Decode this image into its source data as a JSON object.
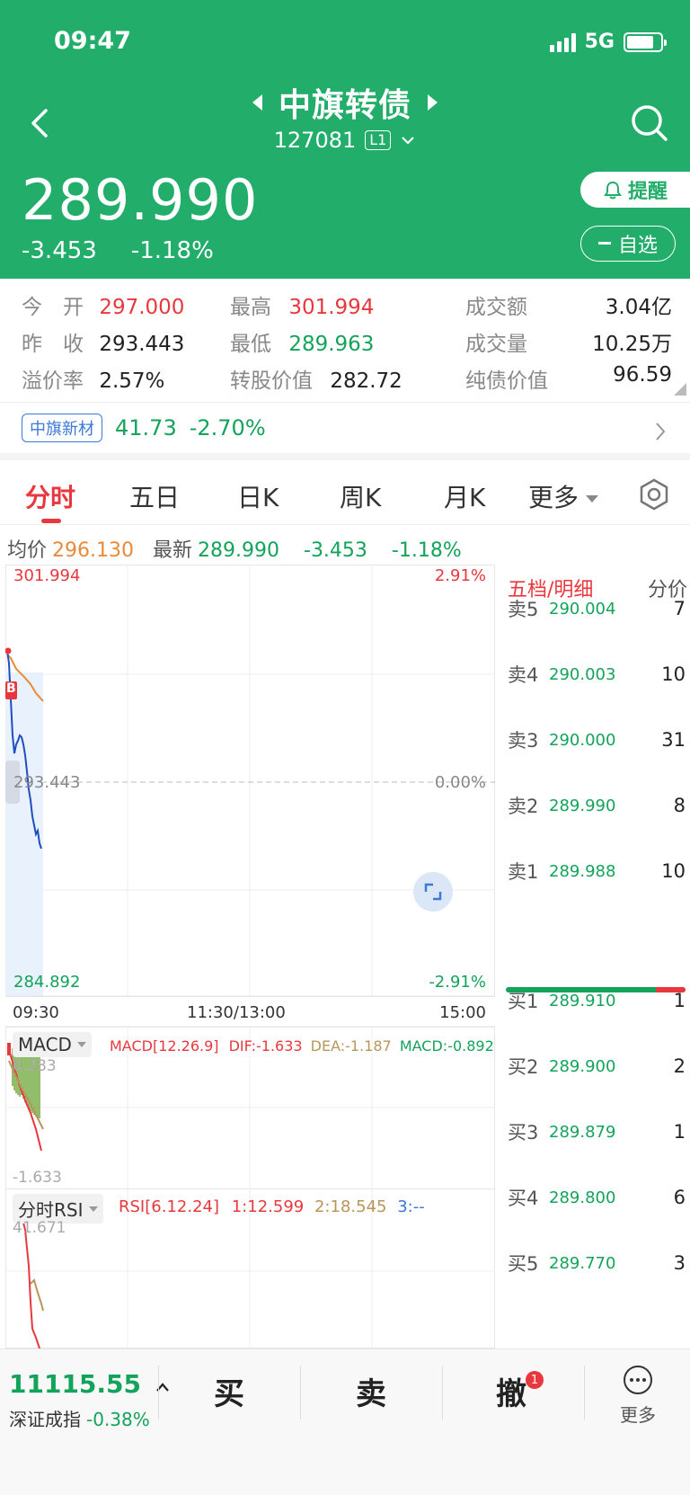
{
  "status_bar": {
    "time": "09:47",
    "network": "5G"
  },
  "header": {
    "title": "中旗转债",
    "code": "127081",
    "level": "L1",
    "price": "289.990",
    "change": "-3.453",
    "change_pct": "-1.18%",
    "alert_label": "提醒",
    "watchlist_label": "自选"
  },
  "stats": {
    "open": {
      "label": "今　开",
      "value": "297.000"
    },
    "high": {
      "label": "最高",
      "value": "301.994"
    },
    "turnover": {
      "label": "成交额",
      "value": "3.04亿"
    },
    "prev_close": {
      "label": "昨　收",
      "value": "293.443"
    },
    "low": {
      "label": "最低",
      "value": "289.963"
    },
    "volume": {
      "label": "成交量",
      "value": "10.25万"
    },
    "premium": {
      "label": "溢价率",
      "value": "2.57%"
    },
    "conv_value": {
      "label": "转股价值",
      "value": "282.72"
    },
    "bond_value": {
      "label": "纯债价值",
      "value": "96.59"
    }
  },
  "related": {
    "name": "中旗新材",
    "price": "41.73",
    "pct": "-2.70%"
  },
  "tabs": [
    "分时",
    "五日",
    "日K",
    "周K",
    "月K",
    "更多"
  ],
  "avg_line": {
    "avg_label": "均价",
    "avg_value": "296.130",
    "latest_label": "最新",
    "latest_value": "289.990",
    "change": "-3.453",
    "pct": "-1.18%"
  },
  "chart": {
    "y_top": "301.994",
    "y_mid": "293.443",
    "y_bottom": "284.892",
    "pct_top": "2.91%",
    "pct_mid": "0.00%",
    "pct_bottom": "-2.91%",
    "marker": "B",
    "x_labels": [
      "09:30",
      "11:30/13:00",
      "15:00"
    ],
    "macd": {
      "name": "MACD",
      "param": "MACD[12.26.9]",
      "dif": "DIF:-1.633",
      "dea": "DEA:-1.187",
      "macd": "MACD:-0.892",
      "y_top": "0.283",
      "y_bottom": "-1.633"
    },
    "rsi": {
      "name": "分时RSI",
      "param": "RSI[6.12.24]",
      "r1": "1:12.599",
      "r2": "2:18.545",
      "r3": "3:--",
      "y_top": "41.671"
    }
  },
  "order_book": {
    "tab_active": "五档/明细",
    "tab_other": "分价",
    "asks": [
      {
        "label": "卖5",
        "price": "290.004",
        "vol": "7"
      },
      {
        "label": "卖4",
        "price": "290.003",
        "vol": "10"
      },
      {
        "label": "卖3",
        "price": "290.000",
        "vol": "31"
      },
      {
        "label": "卖2",
        "price": "289.990",
        "vol": "8"
      },
      {
        "label": "卖1",
        "price": "289.988",
        "vol": "10"
      }
    ],
    "bids": [
      {
        "label": "买1",
        "price": "289.910",
        "vol": "1"
      },
      {
        "label": "买2",
        "price": "289.900",
        "vol": "2"
      },
      {
        "label": "买3",
        "price": "289.879",
        "vol": "1"
      },
      {
        "label": "买4",
        "price": "289.800",
        "vol": "6"
      },
      {
        "label": "买5",
        "price": "289.770",
        "vol": "3"
      }
    ]
  },
  "bottom": {
    "index_value": "11115.55",
    "index_name": "深证成指",
    "index_pct": "-0.38%",
    "buy": "买",
    "sell": "卖",
    "cancel": "撤",
    "cancel_badge": "1",
    "more": "更多"
  },
  "colors": {
    "brand": "#22ad6b",
    "up": "#e8383d",
    "down": "#13a35a"
  }
}
